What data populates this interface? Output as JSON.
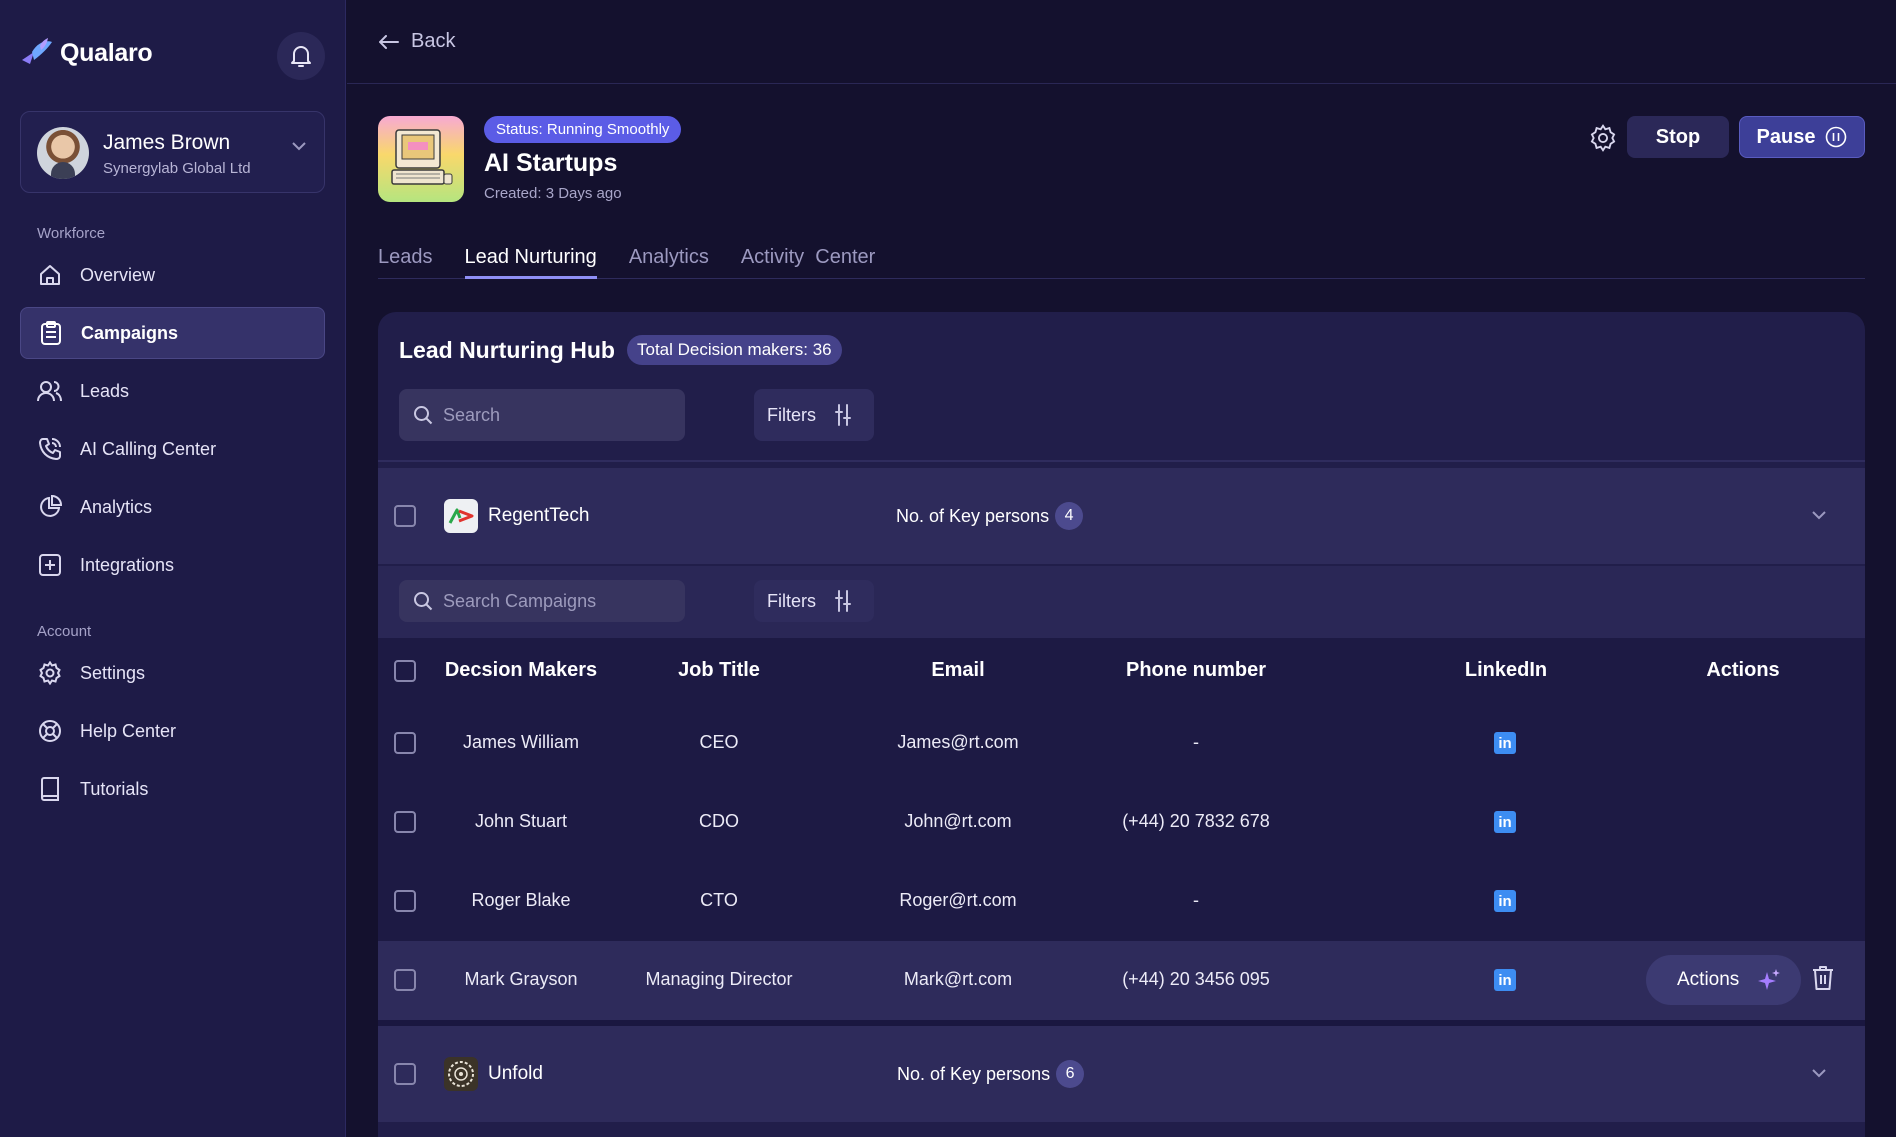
{
  "sidebar": {
    "brand": "Qualaro",
    "user": {
      "name": "James Brown",
      "org": "Synergylab Global Ltd"
    },
    "sections": {
      "workforce": "Workforce",
      "account": "Account"
    },
    "items": [
      {
        "label": "Overview",
        "icon": "home-icon"
      },
      {
        "label": "Campaigns",
        "icon": "clipboard-icon",
        "active": true
      },
      {
        "label": "Leads",
        "icon": "users-icon"
      },
      {
        "label": "AI Calling Center",
        "icon": "phone-icon"
      },
      {
        "label": "Analytics",
        "icon": "pie-chart-icon"
      },
      {
        "label": "Integrations",
        "icon": "plus-square-icon"
      },
      {
        "label": "Settings",
        "icon": "gear-icon"
      },
      {
        "label": "Help Center",
        "icon": "lifebuoy-icon"
      },
      {
        "label": "Tutorials",
        "icon": "book-icon"
      }
    ]
  },
  "topbar": {
    "back_label": "Back"
  },
  "campaign": {
    "status": "Status: Running Smoothly",
    "title": "AI Startups",
    "created": "Created: 3 Days ago",
    "stop_label": "Stop",
    "pause_label": "Pause"
  },
  "tabs": [
    "Leads",
    "Lead Nurturing",
    "Analytics",
    "Activity  Center"
  ],
  "active_tab": "Lead Nurturing",
  "hub": {
    "title": "Lead Nurturing Hub",
    "badge": "Total Decision makers: 36",
    "search_placeholder": "Search",
    "filters_label": "Filters",
    "sub_search_placeholder": "Search Campaigns",
    "sub_filters_label": "Filters"
  },
  "companies": [
    {
      "name": "RegentTech",
      "key_label": "No. of Key persons",
      "count": "4"
    },
    {
      "name": "Unfold",
      "key_label": "No. of Key persons",
      "count": "6"
    }
  ],
  "table": {
    "headers": [
      "Decsion Makers",
      "Job Title",
      "Email",
      "Phone number",
      "LinkedIn",
      "Actions"
    ],
    "rows": [
      {
        "name": "James William",
        "title": "CEO",
        "email": "James@rt.com",
        "phone": "-"
      },
      {
        "name": "John Stuart",
        "title": "CDO",
        "email": "John@rt.com",
        "phone": "(+44) 20 7832 678"
      },
      {
        "name": "Roger Blake",
        "title": "CTO",
        "email": "Roger@rt.com",
        "phone": "-"
      },
      {
        "name": "Mark Grayson",
        "title": "Managing Director",
        "email": "Mark@rt.com",
        "phone": "(+44) 20 3456 095"
      }
    ],
    "linkedin_glyph": "in",
    "actions_label": "Actions"
  },
  "colors": {
    "accent": "#5b5ce6",
    "sidebar": "#1e1b47",
    "background": "#14112e",
    "linkedin": "#3d8df2"
  }
}
